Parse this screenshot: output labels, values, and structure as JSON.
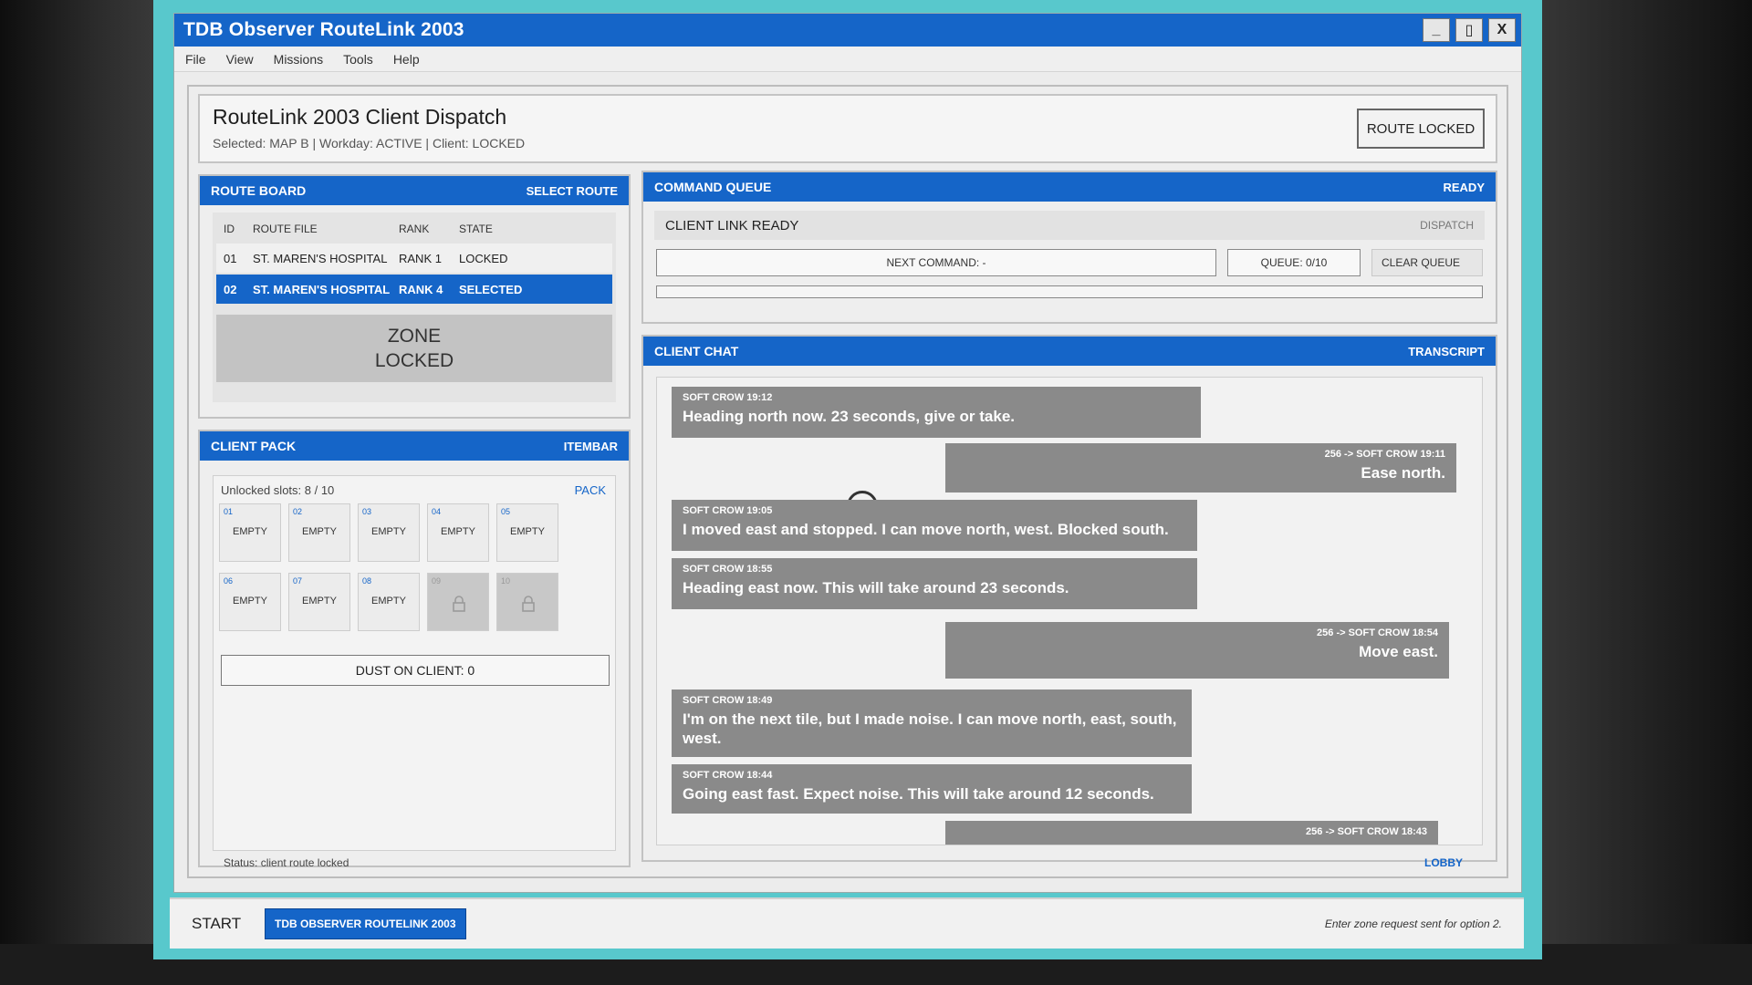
{
  "window": {
    "title": "TDB Observer RouteLink 2003",
    "controls": {
      "minimize": "_",
      "maximize": "▯",
      "close": "X"
    }
  },
  "menu": [
    "File",
    "View",
    "Missions",
    "Tools",
    "Help"
  ],
  "header": {
    "title": "RouteLink 2003 Client Dispatch",
    "subtitle": "Selected: MAP B | Workday: ACTIVE | Client: LOCKED",
    "status_button": "ROUTE LOCKED"
  },
  "route_board": {
    "title": "ROUTE BOARD",
    "action": "SELECT ROUTE",
    "columns": [
      "ID",
      "ROUTE FILE",
      "RANK",
      "STATE"
    ],
    "rows": [
      {
        "id": "01",
        "file": "ST. MAREN'S HOSPITAL",
        "rank": "RANK 1",
        "state": "LOCKED"
      },
      {
        "id": "02",
        "file": "ST. MAREN'S HOSPITAL",
        "rank": "RANK 4",
        "state": "SELECTED"
      }
    ],
    "zone_locked": [
      "ZONE",
      "LOCKED"
    ]
  },
  "client_pack": {
    "title": "CLIENT PACK",
    "action": "ITEMBAR",
    "slots_label": "Unlocked slots: 8 / 10",
    "pack_link": "PACK",
    "slots": [
      {
        "num": "01",
        "label": "EMPTY",
        "locked": false
      },
      {
        "num": "02",
        "label": "EMPTY",
        "locked": false
      },
      {
        "num": "03",
        "label": "EMPTY",
        "locked": false
      },
      {
        "num": "04",
        "label": "EMPTY",
        "locked": false
      },
      {
        "num": "05",
        "label": "EMPTY",
        "locked": false
      },
      {
        "num": "06",
        "label": "EMPTY",
        "locked": false
      },
      {
        "num": "07",
        "label": "EMPTY",
        "locked": false
      },
      {
        "num": "08",
        "label": "EMPTY",
        "locked": false
      },
      {
        "num": "09",
        "label": "",
        "locked": true
      },
      {
        "num": "10",
        "label": "",
        "locked": true
      }
    ],
    "dust": "DUST ON CLIENT: 0"
  },
  "command_queue": {
    "title": "COMMAND QUEUE",
    "status": "READY",
    "link_status": "CLIENT LINK READY",
    "dispatch": "DISPATCH",
    "next_command": "NEXT COMMAND: -",
    "queue": "QUEUE: 0/10",
    "clear": "CLEAR QUEUE"
  },
  "client_chat": {
    "title": "CLIENT CHAT",
    "action": "TRANSCRIPT",
    "messages": [
      {
        "dir": "in",
        "meta": "SOFT CROW 19:12",
        "text": "Heading north now. 23 seconds, give or take."
      },
      {
        "dir": "out",
        "meta": "256 -> SOFT CROW 19:11",
        "text": "Ease north."
      },
      {
        "dir": "in",
        "meta": "SOFT CROW 19:05",
        "text": "I moved east and stopped. I can move north, west. Blocked south."
      },
      {
        "dir": "in",
        "meta": "SOFT CROW 18:55",
        "text": "Heading east now. This will take around 23 seconds."
      },
      {
        "dir": "out",
        "meta": "256 -> SOFT CROW 18:54",
        "text": "Move east."
      },
      {
        "dir": "in",
        "meta": "SOFT CROW 18:49",
        "text": "I'm on the next tile, but I made noise. I can move north, east, south, west."
      },
      {
        "dir": "in",
        "meta": "SOFT CROW 18:44",
        "text": "Going east fast. Expect noise. This will take around 12 seconds."
      },
      {
        "dir": "out",
        "meta": "256 -> SOFT CROW 18:43",
        "text": ""
      }
    ]
  },
  "statusbar": {
    "text": "Status: client route locked",
    "lobby": "LOBBY"
  },
  "taskbar": {
    "start": "START",
    "task": "TDB OBSERVER ROUTELINK 2003",
    "message": "Enter zone request sent for option 2."
  }
}
